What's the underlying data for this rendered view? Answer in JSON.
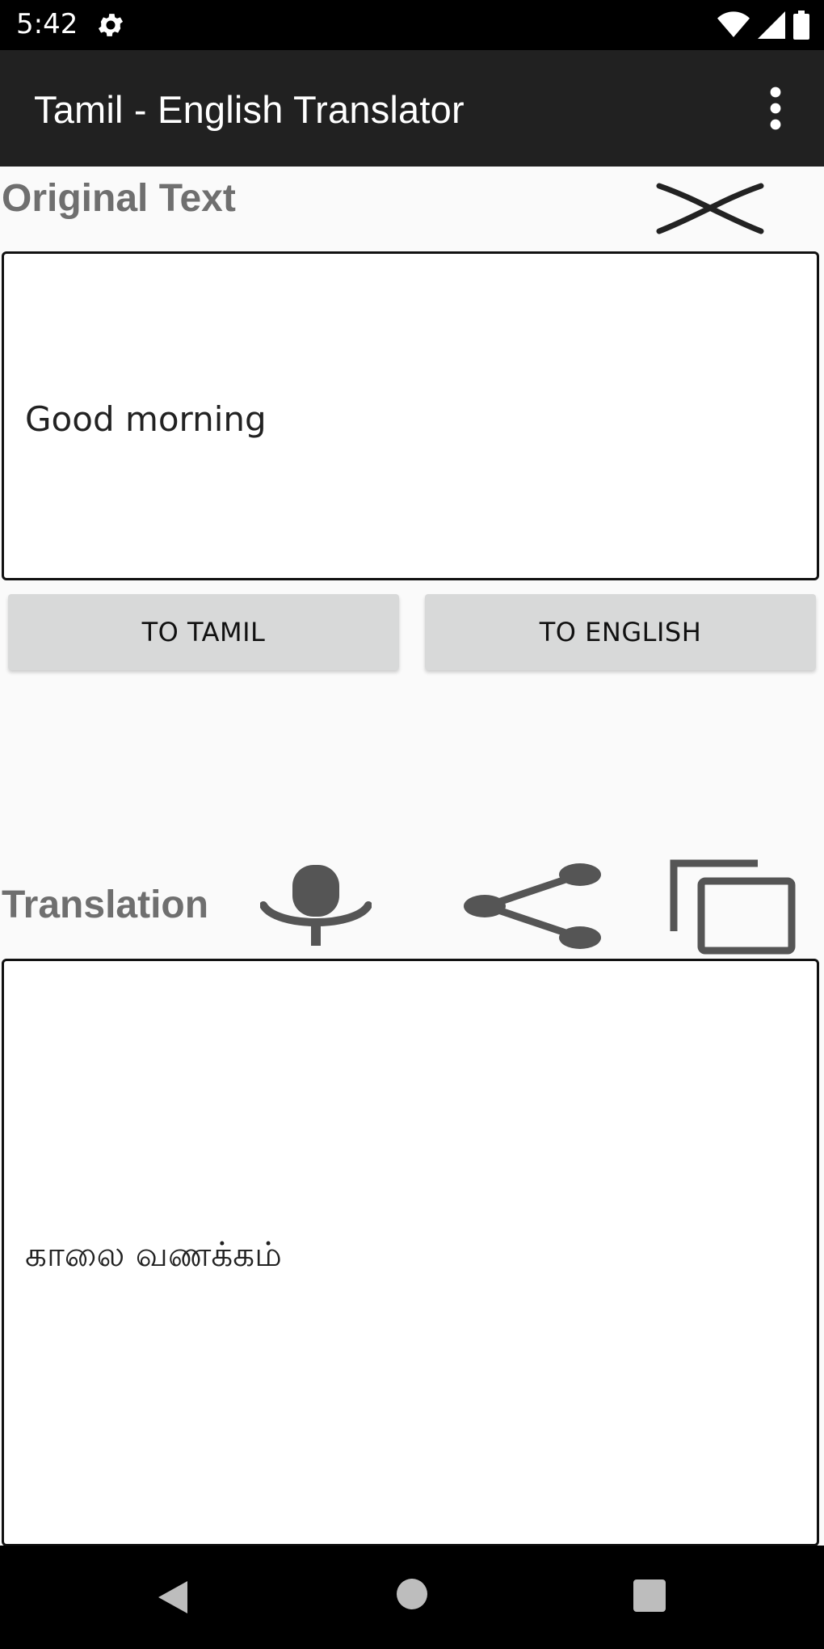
{
  "status_bar": {
    "time": "5:42",
    "icons": [
      "settings-gear-icon",
      "wifi-icon",
      "cellular-signal-icon",
      "battery-icon"
    ]
  },
  "app_bar": {
    "title": "Tamil - English Translator",
    "menu_icon": "more-vert-icon"
  },
  "original": {
    "label": "Original Text",
    "clear_icon": "close-icon",
    "text": "Good morning"
  },
  "buttons": {
    "to_tamil": "TO TAMIL",
    "to_english": "TO ENGLISH"
  },
  "translation": {
    "label": "Translation",
    "icons": [
      "microphone-icon",
      "share-icon",
      "copy-icon"
    ],
    "text": "காலை வணக்கம்"
  },
  "nav_bar": {
    "icons": [
      "back-icon",
      "home-icon",
      "recents-icon"
    ]
  },
  "colors": {
    "app_bar": "#212121",
    "label_gray": "#6f6f6f",
    "icon_gray": "#5a5a5a",
    "button_bg": "#d8d9d9"
  }
}
